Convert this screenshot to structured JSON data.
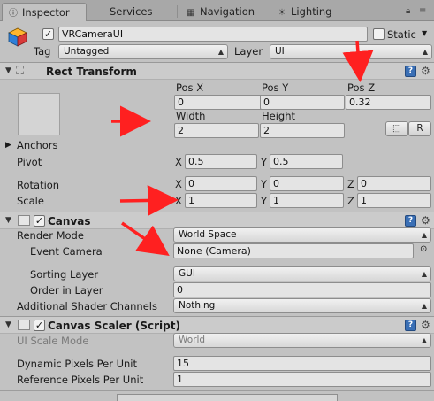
{
  "tabs": [
    {
      "label": "Inspector",
      "icon": "info-icon",
      "active": true
    },
    {
      "label": "Services",
      "icon": "cloud-icon",
      "active": false
    },
    {
      "label": "Navigation",
      "icon": "navigation-icon",
      "active": false
    },
    {
      "label": "Lighting",
      "icon": "lighting-icon",
      "active": false
    }
  ],
  "gameobject": {
    "active": true,
    "name": "VRCameraUI",
    "static_label": "Static",
    "static_checked": false,
    "tag_label": "Tag",
    "tag_value": "Untagged",
    "layer_label": "Layer",
    "layer_value": "UI"
  },
  "rect_transform": {
    "title": "Rect Transform",
    "pos_x_label": "Pos X",
    "pos_y_label": "Pos Y",
    "pos_z_label": "Pos Z",
    "pos_x": "0",
    "pos_y": "0",
    "pos_z": "0.32",
    "width_label": "Width",
    "height_label": "Height",
    "width": "2",
    "height": "2",
    "blueprint_button": "⬚",
    "raw_button": "R",
    "anchors_label": "Anchors",
    "pivot_label": "Pivot",
    "pivot_x": "0.5",
    "pivot_y": "0.5",
    "rotation_label": "Rotation",
    "rotation_x": "0",
    "rotation_y": "0",
    "rotation_z": "0",
    "scale_label": "Scale",
    "scale_x": "1",
    "scale_y": "1",
    "scale_z": "1",
    "axis_x": "X",
    "axis_y": "Y",
    "axis_z": "Z"
  },
  "canvas": {
    "title": "Canvas",
    "enabled": true,
    "render_mode_label": "Render Mode",
    "render_mode_value": "World Space",
    "event_camera_label": "Event Camera",
    "event_camera_value": "None (Camera)",
    "sorting_layer_label": "Sorting Layer",
    "sorting_layer_value": "GUI",
    "order_in_layer_label": "Order in Layer",
    "order_in_layer_value": "0",
    "shader_channels_label": "Additional Shader Channels",
    "shader_channels_value": "Nothing"
  },
  "canvas_scaler": {
    "title": "Canvas Scaler (Script)",
    "enabled": true,
    "ui_scale_mode_label": "UI Scale Mode",
    "ui_scale_mode_value": "World",
    "dynamic_ppu_label": "Dynamic Pixels Per Unit",
    "dynamic_ppu_value": "15",
    "reference_ppu_label": "Reference Pixels Per Unit",
    "reference_ppu_value": "1"
  },
  "colors": {
    "panel_background": "#c2c2c2",
    "annotation_arrow": "#ff2020",
    "help_icon": "#3a6fb5"
  }
}
